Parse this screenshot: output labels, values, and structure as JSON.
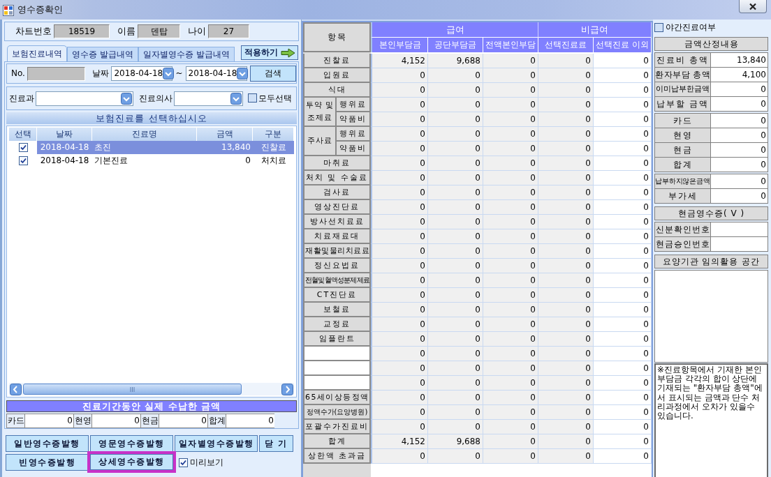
{
  "window": {
    "title": "영수증확인"
  },
  "patient": [
    {
      "label": "차트번호",
      "value": "18519"
    },
    {
      "label": "이름",
      "value": "덴탑"
    },
    {
      "label": "나이",
      "value": "27"
    }
  ],
  "tabs": [
    {
      "label": "보험진료내역",
      "selected": true
    },
    {
      "label": "영수증 발급내역",
      "selected": false
    },
    {
      "label": "일자별영수증 발급내역",
      "selected": false
    }
  ],
  "apply_button": {
    "label": "적용하기"
  },
  "search": {
    "number_label": "No.",
    "date_label": "날짜",
    "date_from": "2018-04-18",
    "range_separator": "~",
    "date_to": "2018-04-18",
    "button": "검색"
  },
  "filters": {
    "department_label": "진료과",
    "doctor_label": "진료의사",
    "select_all": {
      "label": "모두선택",
      "checked": false
    }
  },
  "treatment_list": {
    "title": "보험진료를 선택하십시오",
    "columns": [
      "선택",
      "날짜",
      "진료명",
      "금액",
      "구분"
    ],
    "rows": [
      {
        "checked": true,
        "selected": true,
        "date": "2018-04-18",
        "name": "초진",
        "amount": "13,840",
        "category": "진찰료"
      },
      {
        "checked": true,
        "selected": false,
        "date": "2018-04-18",
        "name": "기본진료",
        "amount": "0",
        "category": "처치료"
      }
    ]
  },
  "paid_summary": {
    "title": "진료기간동안 실제 수납한 금액",
    "items": [
      {
        "label": "카드",
        "value": "0"
      },
      {
        "label": "현영",
        "value": "0"
      },
      {
        "label": "현금",
        "value": "0"
      },
      {
        "label": "합계",
        "value": "0"
      }
    ]
  },
  "actions": {
    "buttons": [
      {
        "label": "일반영수증발행",
        "highlighted": false
      },
      {
        "label": "영문영수증발행",
        "highlighted": false
      },
      {
        "label": "일자별영수증발행",
        "highlighted": false
      },
      {
        "label": "닫 기",
        "highlighted": false
      },
      {
        "label": "빈영수증발행",
        "highlighted": false
      },
      {
        "label": "상세영수증발행",
        "highlighted": true
      }
    ],
    "preview": {
      "label": "미리보기",
      "checked": true
    }
  },
  "fee_table": {
    "header": "항목",
    "groups": [
      {
        "label": "급여",
        "columns": [
          "본인부담금",
          "공단부담금",
          "전액본인부담"
        ]
      },
      {
        "label": "비급여",
        "columns": [
          "선택진료료",
          "선택진료 이외"
        ]
      }
    ],
    "rows": [
      {
        "kind": "item",
        "label": "진찰료",
        "values": [
          "4,152",
          "9,688",
          "0",
          "0",
          "0"
        ]
      },
      {
        "kind": "item",
        "label": "입원료",
        "values": [
          "0",
          "0",
          "0",
          "0",
          "0"
        ]
      },
      {
        "kind": "item",
        "label": "식대",
        "values": [
          "0",
          "0",
          "0",
          "0",
          "0"
        ]
      },
      {
        "kind": "group",
        "label": "투약 및 조제료",
        "children": [
          {
            "label": "행위료",
            "values": [
              "0",
              "0",
              "0",
              "0",
              "0"
            ]
          },
          {
            "label": "약품비",
            "values": [
              "0",
              "0",
              "0",
              "0",
              "0"
            ]
          }
        ]
      },
      {
        "kind": "group",
        "label": "주사료",
        "children": [
          {
            "label": "행위료",
            "values": [
              "0",
              "0",
              "0",
              "0",
              "0"
            ]
          },
          {
            "label": "약품비",
            "values": [
              "0",
              "0",
              "0",
              "0",
              "0"
            ]
          }
        ]
      },
      {
        "kind": "item",
        "label": "마취료",
        "values": [
          "0",
          "0",
          "0",
          "0",
          "0"
        ]
      },
      {
        "kind": "item",
        "label": "처치 및 수술료",
        "values": [
          "0",
          "0",
          "0",
          "0",
          "0"
        ]
      },
      {
        "kind": "item",
        "label": "검사료",
        "values": [
          "0",
          "0",
          "0",
          "0",
          "0"
        ]
      },
      {
        "kind": "item",
        "label": "영상진단료",
        "values": [
          "0",
          "0",
          "0",
          "0",
          "0"
        ]
      },
      {
        "kind": "item",
        "label": "방사선치료료",
        "values": [
          "0",
          "0",
          "0",
          "0",
          "0"
        ]
      },
      {
        "kind": "item",
        "label": "치료재료대",
        "values": [
          "0",
          "0",
          "0",
          "0",
          "0"
        ]
      },
      {
        "kind": "item",
        "label": "재활및물리치료료",
        "values": [
          "0",
          "0",
          "0",
          "0",
          "0"
        ]
      },
      {
        "kind": "item",
        "label": "정신요법료",
        "values": [
          "0",
          "0",
          "0",
          "0",
          "0"
        ]
      },
      {
        "kind": "item",
        "label": "전혈및혈액성분제제료",
        "values": [
          "0",
          "0",
          "0",
          "0",
          "0"
        ]
      },
      {
        "kind": "item",
        "label": "CT진단료",
        "values": [
          "0",
          "0",
          "0",
          "0",
          "0"
        ]
      },
      {
        "kind": "item",
        "label": "보철료",
        "values": [
          "0",
          "0",
          "0",
          "0",
          "0"
        ]
      },
      {
        "kind": "item",
        "label": "교정료",
        "values": [
          "0",
          "0",
          "0",
          "0",
          "0"
        ]
      },
      {
        "kind": "item",
        "label": "임플란트",
        "values": [
          "0",
          "0",
          "0",
          "0",
          "0"
        ]
      },
      {
        "kind": "blank",
        "values": [
          "0",
          "0",
          "0",
          "0",
          "0"
        ]
      },
      {
        "kind": "blank",
        "values": [
          "0",
          "0",
          "0",
          "0",
          "0"
        ]
      },
      {
        "kind": "blank",
        "values": [
          "0",
          "0",
          "0",
          "0",
          "0"
        ]
      },
      {
        "kind": "item",
        "label": "65세이상등정액",
        "values": [
          "0",
          "0",
          "0",
          "0",
          "0"
        ]
      },
      {
        "kind": "item",
        "label": "정액수가(요양병원)",
        "values": [
          "0",
          "0",
          "0",
          "0",
          "0"
        ]
      },
      {
        "kind": "item",
        "label": "포괄수가진료비",
        "values": [
          "0",
          "0",
          "0",
          "0",
          "0"
        ]
      },
      {
        "kind": "item",
        "label": "합계",
        "values": [
          "4,152",
          "9,688",
          "0",
          "0",
          "0"
        ]
      },
      {
        "kind": "item",
        "label": "상한액 초과금",
        "values": [
          "0",
          "0",
          "0",
          "0",
          "0"
        ]
      }
    ]
  },
  "calculation": {
    "night_care": {
      "label": "야간진료여부",
      "checked": false
    },
    "title": "금액산정내용",
    "groups": [
      {
        "items": [
          {
            "label": "진료비 총액",
            "value": "13,840"
          },
          {
            "label": "환자부담 총액",
            "value": "4,100"
          },
          {
            "label": "이미납부한금액",
            "value": "0"
          },
          {
            "label": "납부할 금액",
            "value": "0"
          }
        ]
      },
      {
        "items": [
          {
            "label": "카드",
            "value": "0"
          },
          {
            "label": "현영",
            "value": "0"
          },
          {
            "label": "현금",
            "value": "0"
          },
          {
            "label": "합계",
            "value": "0"
          }
        ]
      },
      {
        "items": [
          {
            "label": "납부하지않은금액",
            "value": "0"
          },
          {
            "label": "부가세",
            "value": "0"
          }
        ]
      }
    ],
    "cash_receipt": {
      "title": "현금영수증( V )",
      "fields": [
        {
          "label": "신분확인번호"
        },
        {
          "label": "현금승인번호"
        }
      ]
    },
    "free_space": {
      "title": "요양기관 임의활용 공간"
    },
    "note": "※진료항목에서 기재한 본인부담금 각각의 합이 상단에 기재되는 \"환자부담 총액\"에서 표시되는 금액과 단수 처리과정에서 오차가 있을수 있습니다."
  }
}
